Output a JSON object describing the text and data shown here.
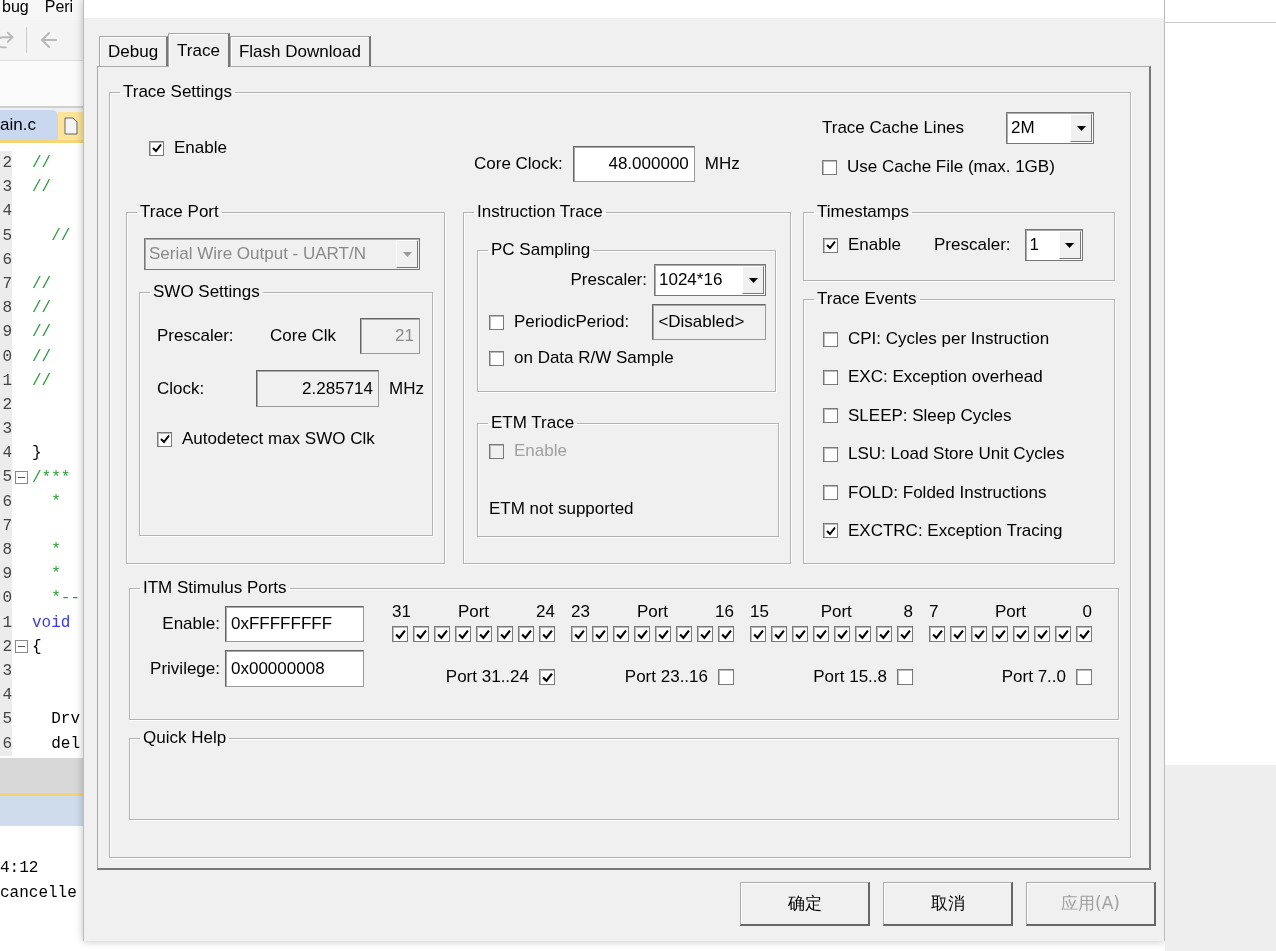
{
  "ide": {
    "menu": [
      "bug",
      "Peri"
    ],
    "file_tab": "ain.c",
    "code_lines": [
      {
        "number": "2",
        "text": "//",
        "kind": "comment",
        "fold": false
      },
      {
        "number": "3",
        "text": "//",
        "kind": "comment",
        "fold": false
      },
      {
        "number": "4",
        "fold": false
      },
      {
        "number": "5",
        "text": "  //",
        "kind": "comment",
        "fold": false
      },
      {
        "number": "6",
        "fold": false
      },
      {
        "number": "7",
        "text": "//",
        "kind": "comment",
        "fold": false
      },
      {
        "number": "8",
        "text": "//",
        "kind": "comment",
        "fold": false
      },
      {
        "number": "9",
        "text": "//",
        "kind": "comment",
        "fold": false
      },
      {
        "number": "0",
        "text": "//",
        "kind": "comment",
        "fold": false
      },
      {
        "number": "1",
        "text": "//",
        "kind": "comment",
        "fold": false
      },
      {
        "number": "2",
        "fold": false
      },
      {
        "number": "3",
        "fold": false
      },
      {
        "number": "4",
        "text": "}",
        "kind": "plain",
        "fold": false
      },
      {
        "number": "5",
        "text": "/***",
        "kind": "comment",
        "fold": true
      },
      {
        "number": "6",
        "text": "  *",
        "kind": "comment",
        "fold": false
      },
      {
        "number": "7",
        "fold": false
      },
      {
        "number": "8",
        "text": "  *",
        "kind": "comment",
        "fold": false
      },
      {
        "number": "9",
        "text": "  *",
        "kind": "comment",
        "fold": false
      },
      {
        "number": "0",
        "text": "  *--",
        "kind": "comment",
        "fold": false
      },
      {
        "number": "1",
        "text": "void",
        "kind": "keyword",
        "fold": false
      },
      {
        "number": "2",
        "text": "{",
        "kind": "plain",
        "fold": true
      },
      {
        "number": "3",
        "fold": false
      },
      {
        "number": "4",
        "fold": false
      },
      {
        "number": "5",
        "text": "  Drv",
        "kind": "plain",
        "fold": false
      },
      {
        "number": "6",
        "text": "  del",
        "kind": "plain",
        "fold": false
      }
    ],
    "output_lines": [
      "4:12",
      "cancelle"
    ]
  },
  "tabs": [
    {
      "label": "Debug",
      "selected": false
    },
    {
      "label": "Trace",
      "selected": true
    },
    {
      "label": "Flash Download",
      "selected": false
    }
  ],
  "trace_settings": {
    "title": "Trace Settings",
    "enable": {
      "label": "Enable",
      "checked": true
    },
    "core_clock": {
      "label": "Core Clock:",
      "value": "48.000000",
      "unit": "MHz"
    },
    "cache_lines": {
      "label": "Trace Cache Lines",
      "value": "2M"
    },
    "use_cache_file": {
      "label": "Use Cache File (max. 1GB)",
      "checked": false
    },
    "trace_port": {
      "title": "Trace Port",
      "select": {
        "value": "Serial Wire Output - UART/N",
        "disabled": true
      },
      "swo": {
        "title": "SWO Settings",
        "prescaler_label": "Prescaler:",
        "core_clk_label": "Core Clk",
        "prescaler_value": "21",
        "prescaler_disabled": true,
        "clock_label": "Clock:",
        "clock_value": "2.285714",
        "clock_unit": "MHz",
        "autodetect": {
          "label": "Autodetect max SWO Clk",
          "checked": true
        }
      }
    },
    "instruction_trace": {
      "title": "Instruction Trace",
      "pc_sampling": {
        "title": "PC Sampling",
        "prescaler_label": "Prescaler:",
        "prescaler_value": "1024*16",
        "periodic": {
          "label": "PeriodicPeriod:",
          "checked": false,
          "value": "<Disabled>"
        },
        "data_rw": {
          "label": "on Data R/W Sample",
          "checked": false
        }
      },
      "etm": {
        "title": "ETM Trace",
        "enable": {
          "label": "Enable",
          "checked": false,
          "disabled": true
        },
        "note": "ETM not supported"
      }
    },
    "timestamps": {
      "title": "Timestamps",
      "enable": {
        "label": "Enable",
        "checked": true
      },
      "prescaler_label": "Prescaler:",
      "prescaler_value": "1"
    },
    "trace_events": {
      "title": "Trace Events",
      "items": [
        {
          "label": "CPI: Cycles per Instruction",
          "checked": false
        },
        {
          "label": "EXC: Exception overhead",
          "checked": false
        },
        {
          "label": "SLEEP: Sleep Cycles",
          "checked": false
        },
        {
          "label": "LSU: Load Store Unit Cycles",
          "checked": false
        },
        {
          "label": "FOLD: Folded Instructions",
          "checked": false
        },
        {
          "label": "EXCTRC: Exception Tracing",
          "checked": true
        }
      ]
    },
    "itm": {
      "title": "ITM Stimulus Ports",
      "enable_label": "Enable:",
      "enable_value": "0xFFFFFFFF",
      "privilege_label": "Privilege:",
      "privilege_value": "0x00000008",
      "groups": [
        {
          "high": "31",
          "label": "Port",
          "low": "24",
          "bits": [
            {
              "checked": true
            },
            {
              "checked": true
            },
            {
              "checked": true
            },
            {
              "checked": true
            },
            {
              "checked": true
            },
            {
              "checked": true
            },
            {
              "checked": true
            },
            {
              "checked": true
            }
          ],
          "port_label": "Port 31..24",
          "port_checked": true
        },
        {
          "high": "23",
          "label": "Port",
          "low": "16",
          "bits": [
            {
              "checked": true
            },
            {
              "checked": true
            },
            {
              "checked": true
            },
            {
              "checked": true
            },
            {
              "checked": true
            },
            {
              "checked": true
            },
            {
              "checked": true
            },
            {
              "checked": true
            }
          ],
          "port_label": "Port 23..16",
          "port_checked": false
        },
        {
          "high": "15",
          "label": "Port",
          "low": "8",
          "bits": [
            {
              "checked": true
            },
            {
              "checked": true
            },
            {
              "checked": true
            },
            {
              "checked": true
            },
            {
              "checked": true
            },
            {
              "checked": true
            },
            {
              "checked": true
            },
            {
              "checked": true
            }
          ],
          "port_label": "Port 15..8",
          "port_checked": false
        },
        {
          "high": "7",
          "label": "Port",
          "low": "0",
          "bits": [
            {
              "checked": true
            },
            {
              "checked": true
            },
            {
              "checked": true
            },
            {
              "checked": true
            },
            {
              "checked": true
            },
            {
              "checked": true
            },
            {
              "checked": true
            },
            {
              "checked": true
            }
          ],
          "port_label": "Port 7..0",
          "port_checked": false
        }
      ]
    },
    "quick_help": {
      "title": "Quick Help"
    }
  },
  "buttons": [
    {
      "label": "确定",
      "disabled": false
    },
    {
      "label": "取消",
      "disabled": false
    },
    {
      "label": "应用(A)",
      "disabled": true
    }
  ]
}
